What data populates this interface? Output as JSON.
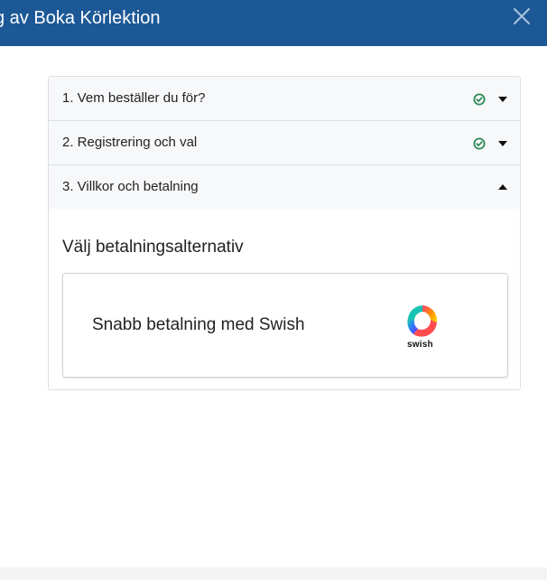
{
  "header": {
    "title": "g av Boka Körlektion",
    "bg_color": "#1c5896",
    "close_icon": "close-icon"
  },
  "accordion": {
    "items": [
      {
        "label": "1. Vem beställer du för?",
        "status": "completed",
        "expanded": false
      },
      {
        "label": "2. Registrering och val",
        "status": "completed",
        "expanded": false
      },
      {
        "label": "3. Villkor och betalning",
        "status": "active",
        "expanded": true
      }
    ],
    "check_color": "#2e8b57"
  },
  "payment": {
    "heading": "Välj betalningsalternativ",
    "options": [
      {
        "label": "Snabb betalning med Swish",
        "logo_text": "swish"
      }
    ]
  }
}
